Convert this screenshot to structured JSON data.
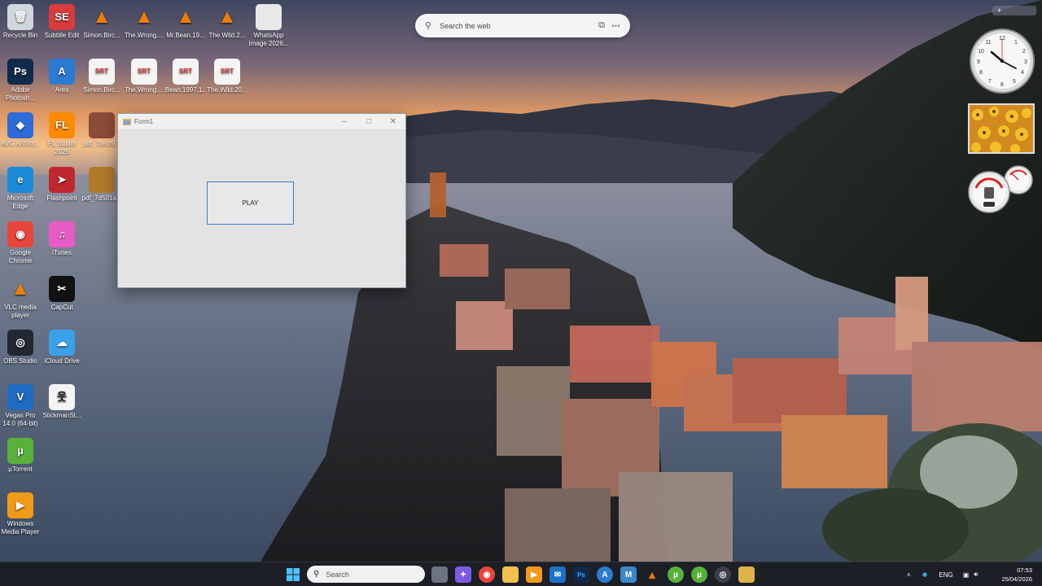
{
  "desktop_icons": [
    {
      "label": "Recycle Bin",
      "icon": "recycle-bin-icon",
      "color": "#cfd6de",
      "glyph": "🗑"
    },
    {
      "label": "Subtitle Edit",
      "icon": "subtitle-edit-icon",
      "color": "#d83b3b",
      "glyph": "SE"
    },
    {
      "label": "Simon.Birc...",
      "icon": "vlc-file-icon",
      "color": "#f07d00",
      "glyph": "▲"
    },
    {
      "label": "The.Wrong....",
      "icon": "vlc-file-icon",
      "color": "#f07d00",
      "glyph": "▲"
    },
    {
      "label": "Mr.Bean.19...",
      "icon": "vlc-file-icon",
      "color": "#f07d00",
      "glyph": "▲"
    },
    {
      "label": "The.Wild.2...",
      "icon": "vlc-file-icon",
      "color": "#f07d00",
      "glyph": "▲"
    },
    {
      "label": "WhatsApp Image 2026...",
      "icon": "image-file-icon",
      "color": "#e8e8e8",
      "glyph": ""
    },
    {
      "label": "Adobe Photosh...",
      "icon": "photoshop-icon",
      "color": "#0f2a4a",
      "glyph": "Ps"
    },
    {
      "label": "Ares",
      "icon": "ares-icon",
      "color": "#2a7bd1",
      "glyph": "A"
    },
    {
      "label": "Simon.Birc...",
      "icon": "srt-file-icon",
      "color": "#f4f4f4",
      "glyph": "SRT"
    },
    {
      "label": "The.Wrong....",
      "icon": "srt-file-icon",
      "color": "#f4f4f4",
      "glyph": "SRT"
    },
    {
      "label": "Bean.1997.1...",
      "icon": "srt-file-icon",
      "color": "#f4f4f4",
      "glyph": "SRT"
    },
    {
      "label": "The.Wild.20...",
      "icon": "srt-file-icon",
      "color": "#f4f4f4",
      "glyph": "SRT"
    },
    {
      "label": "AVG AntiVir...",
      "icon": "avg-icon",
      "color": "#2d6bd6",
      "glyph": "◆"
    },
    {
      "label": "FL Studio 2025",
      "icon": "fl-studio-icon",
      "color": "#ff8a00",
      "glyph": "FL"
    },
    {
      "label": "pdf_7b6cf9...",
      "icon": "pdf-image-icon",
      "color": "#8a4b3a",
      "glyph": ""
    },
    {
      "label": "Microsoft Edge",
      "icon": "edge-icon",
      "color": "#1a8ad8",
      "glyph": "e"
    },
    {
      "label": "Flashpoint",
      "icon": "flashpoint-icon",
      "color": "#c0282f",
      "glyph": "➤"
    },
    {
      "label": "pdf_7d501a...",
      "icon": "pdf-image-icon",
      "color": "#b07a2a",
      "glyph": ""
    },
    {
      "label": "Google Chrome",
      "icon": "chrome-icon",
      "color": "#e8453c",
      "glyph": "◉"
    },
    {
      "label": "iTunes",
      "icon": "itunes-icon",
      "color": "#e85bc4",
      "glyph": "♫"
    },
    {
      "label": "VLC media player",
      "icon": "vlc-icon",
      "color": "#f07d00",
      "glyph": "▲"
    },
    {
      "label": "CapCut",
      "icon": "capcut-icon",
      "color": "#111111",
      "glyph": "✂"
    },
    {
      "label": "OBS Studio",
      "icon": "obs-icon",
      "color": "#222833",
      "glyph": "◎"
    },
    {
      "label": "iCloud Drive",
      "icon": "icloud-icon",
      "color": "#3aa0e8",
      "glyph": "☁"
    },
    {
      "label": "Vegas Pro 14.0 (64-bit)",
      "icon": "vegas-pro-icon",
      "color": "#1f6bc2",
      "glyph": "V"
    },
    {
      "label": "StickmanSt...",
      "icon": "stickman-icon",
      "color": "#f4f4f4",
      "glyph": "웃"
    },
    {
      "label": "µTorrent",
      "icon": "utorrent-icon",
      "color": "#58b13a",
      "glyph": "µ"
    },
    {
      "label": "Windows Media Player",
      "icon": "windows-media-player-icon",
      "color": "#f09a1a",
      "glyph": "▶"
    }
  ],
  "search_widget": {
    "placeholder": "Search the web"
  },
  "window": {
    "title": "Form1",
    "play_label": "PLAY"
  },
  "taskbar": {
    "search_label": "Search",
    "language": "ENG",
    "time": "07:53",
    "date": "25/04/2026"
  },
  "colors": {
    "accent": "#3d7ac7",
    "taskbar": "#1c1f26"
  }
}
